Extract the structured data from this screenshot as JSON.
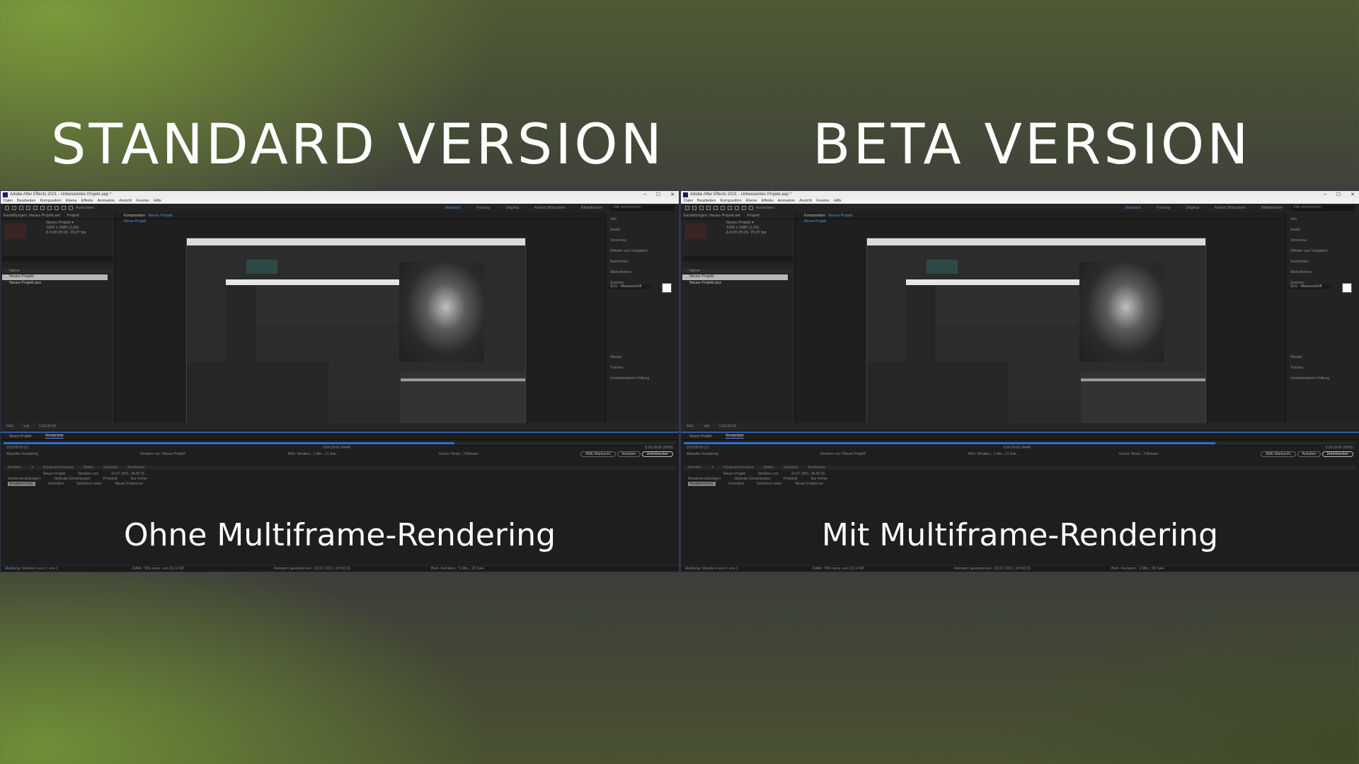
{
  "headings": {
    "left": "STANDARD VERSION",
    "right": "BETA VERSION"
  },
  "panels": [
    {
      "window_title": "Adobe After Effects 2021 - Unbenanntes Projekt.aep *",
      "caption": "Ohne Multiframe-Rendering",
      "render_progress": 0.67,
      "footer": {
        "message": "Meldung: Rendern von 1 von 1",
        "ram": "RAM: 73% verw. von 31,9 GB",
        "started": "Rendern gestartet am: 23.07.2021, 08:50:15",
        "elapsed": "Bish. Renderz.: 5 Min., 23 Sek."
      }
    },
    {
      "window_title": "Adobe After Effects 2021 - Unbenanntes Projekt.aep *",
      "caption": "Mit Multiframe-Rendering",
      "render_progress": 0.79,
      "footer": {
        "message": "Meldung: Rendern von 1 von 1",
        "ram": "RAM: 73% verw. von 31,9 GB",
        "started": "Rendern gestartet am: 23.07.2021, 08:50:15",
        "elapsed": "Bish. Renderz.: 3 Min., 55 Sek."
      }
    }
  ],
  "window_controls": [
    "–",
    "☐",
    "✕"
  ],
  "menu": [
    "Datei",
    "Bearbeiten",
    "Komposition",
    "Ebene",
    "Effekte",
    "Animation",
    "Ansicht",
    "Fenster",
    "Hilfe"
  ],
  "toolbar": {
    "align_label": "Ausrichten",
    "workspaces": [
      "Standard",
      "Training",
      "Original",
      "Kleiner Bildschirm",
      "Bibliotheken"
    ],
    "help_search": "Hilfe durchsuchen"
  },
  "project": {
    "tabs": [
      "Einstellungen: Neues Projekt.aet",
      "Projekt"
    ],
    "comp_name": "Neues Projekt ▾",
    "comp_size": "1920 x 1080 (1,00)",
    "comp_duration": "Δ 0:00:29:29, 29,97 fps",
    "column_header": "Name",
    "items": [
      "Neues Projekt",
      "Neues Projekt.aux"
    ]
  },
  "composition": {
    "tab_prefix": "Komposition",
    "tab_name": "Neues Projekt",
    "sub_tab": "Neues Projekt"
  },
  "properties": {
    "items": [
      "Info",
      "Audio",
      "Vorschau",
      "Effekte und Vorgaben",
      "Ausrichten",
      "Bibliotheken",
      "Zeichen",
      "",
      "",
      "",
      "",
      "",
      "Absatz",
      "Tracker",
      "Inhaltsbasierte Füllung"
    ],
    "font_name": "SLG - Wasserschrift",
    "font_style": "Bold"
  },
  "statusbar": [
    "50%",
    "Voll",
    "0:00:29:29"
  ],
  "render_queue": {
    "tabs": [
      "Neues Projekt",
      "Renderliste"
    ],
    "timecode_start": "0:00:00:00 (1)",
    "timecode_mid": "0:04:29:00 (4444)",
    "timecode_end": "0:06:29:00 (5995)",
    "current": "Aktuellen Rendering",
    "rendering_label": "Rendern von \"Neues Projekt\"",
    "elapsed_label": "Bish. Renderz.: 1 Min., 21 Sek.",
    "remaining_label": "Gesch. Restz.: 3 Minuten",
    "buttons": [
      "AME-Warteschl.",
      "Anhalten",
      "Unterbrechen"
    ],
    "columns": [
      "Rendern",
      "#",
      "Kompositionsname",
      "Status",
      "Gestartet",
      "Renderzeit"
    ],
    "row_comp": "Neues Projekt",
    "row_status": "Rendern von",
    "row_started": "23.07.2021, 08:50:15",
    "settings_label": "Rendereinstellungen:",
    "settings_value": "Optimale Einstellungen",
    "log_label": "Protokoll:",
    "log_value": "Nur Fehler",
    "output_label": "Ausgabemodul:",
    "output_value": "Verlustfrei",
    "save_label": "Speichern unter:",
    "save_value": "Neues Projekt.avi"
  }
}
